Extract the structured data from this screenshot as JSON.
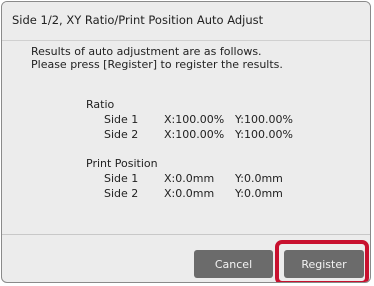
{
  "dialog": {
    "title": "Side 1/2, XY Ratio/Print Position Auto Adjust",
    "message_line1": "Results of auto adjustment are as follows.",
    "message_line2": "Please press [Register] to register the results."
  },
  "ratio": {
    "label": "Ratio",
    "rows": [
      {
        "side": "Side 1",
        "x": "X:100.00%",
        "y": "Y:100.00%"
      },
      {
        "side": "Side 2",
        "x": "X:100.00%",
        "y": "Y:100.00%"
      }
    ]
  },
  "print_position": {
    "label": "Print Position",
    "rows": [
      {
        "side": "Side 1",
        "x": "X:0.0mm",
        "y": "Y:0.0mm"
      },
      {
        "side": "Side 2",
        "x": "X:0.0mm",
        "y": "Y:0.0mm"
      }
    ]
  },
  "buttons": {
    "cancel_label": "Cancel",
    "register_label": "Register"
  },
  "colors": {
    "highlight": "#c8102e",
    "button": "#6b6b6b"
  }
}
